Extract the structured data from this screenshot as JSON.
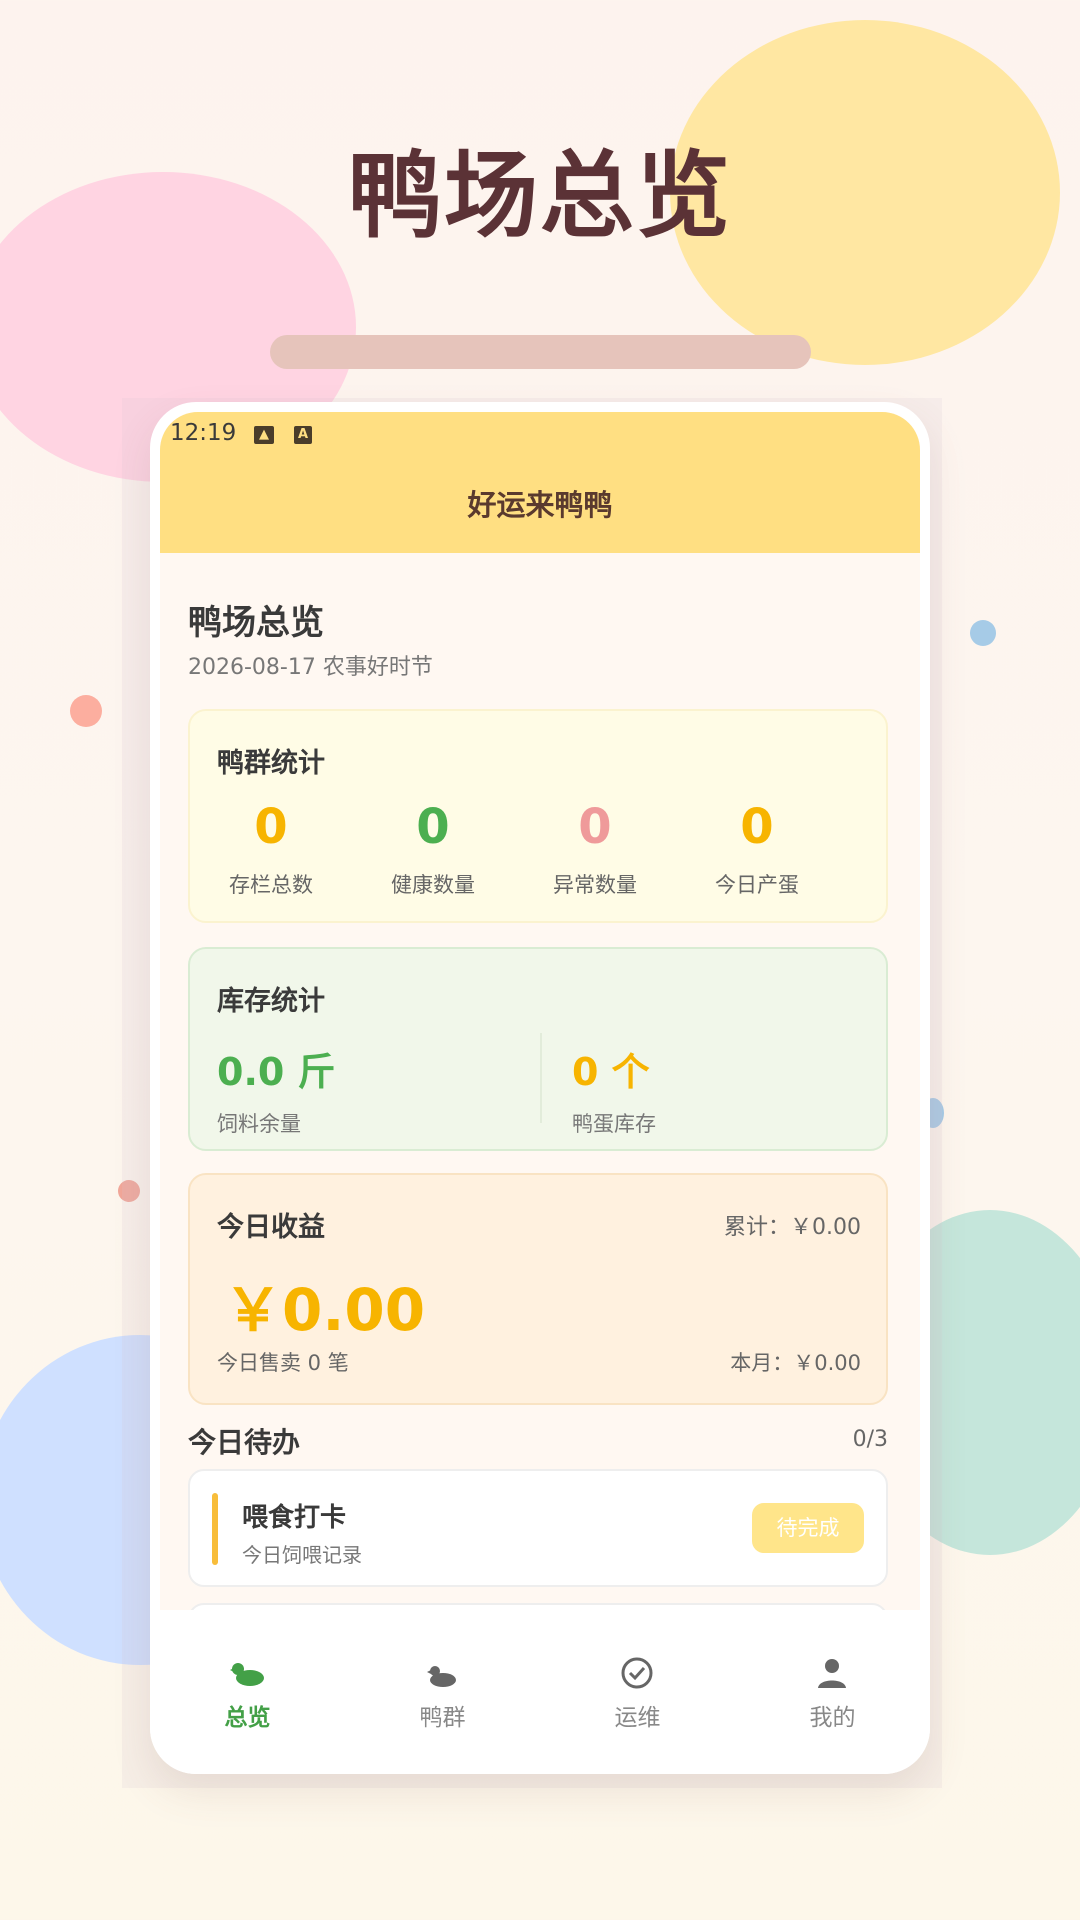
{
  "hero": {
    "title": "鸭场总览"
  },
  "status_bar": {
    "time": "12:19"
  },
  "app_bar": {
    "title": "好运来鸭鸭"
  },
  "page": {
    "title": "鸭场总览",
    "date_line": "2026-08-17 农事好时节"
  },
  "flock_stats": {
    "title": "鸭群统计",
    "items": [
      {
        "value": "0",
        "label": "存栏总数",
        "color": "#f7b400"
      },
      {
        "value": "0",
        "label": "健康数量",
        "color": "#4caf50"
      },
      {
        "value": "0",
        "label": "异常数量",
        "color": "#ef9a9a"
      },
      {
        "value": "0",
        "label": "今日产蛋",
        "color": "#f7b400"
      }
    ]
  },
  "inventory": {
    "title": "库存统计",
    "feed": {
      "value": "0.0 斤",
      "label": "饲料余量",
      "color": "#4caf50"
    },
    "eggs": {
      "value": "0 个",
      "label": "鸭蛋库存",
      "color": "#f7b400"
    }
  },
  "income": {
    "title": "今日收益",
    "total": "累计：￥0.00",
    "amount": "￥0.00",
    "sales": "今日售卖 0 笔",
    "month": "本月：￥0.00"
  },
  "todo": {
    "title": "今日待办",
    "count": "0/3",
    "tasks": [
      {
        "name": "喂食打卡",
        "desc": "今日饲喂记录",
        "status": "待完成"
      }
    ]
  },
  "tabs": [
    {
      "label": "总览",
      "icon": "duck-icon",
      "active": true
    },
    {
      "label": "鸭群",
      "icon": "flock-icon",
      "active": false
    },
    {
      "label": "运维",
      "icon": "check-circle-icon",
      "active": false
    },
    {
      "label": "我的",
      "icon": "person-icon",
      "active": false
    }
  ]
}
